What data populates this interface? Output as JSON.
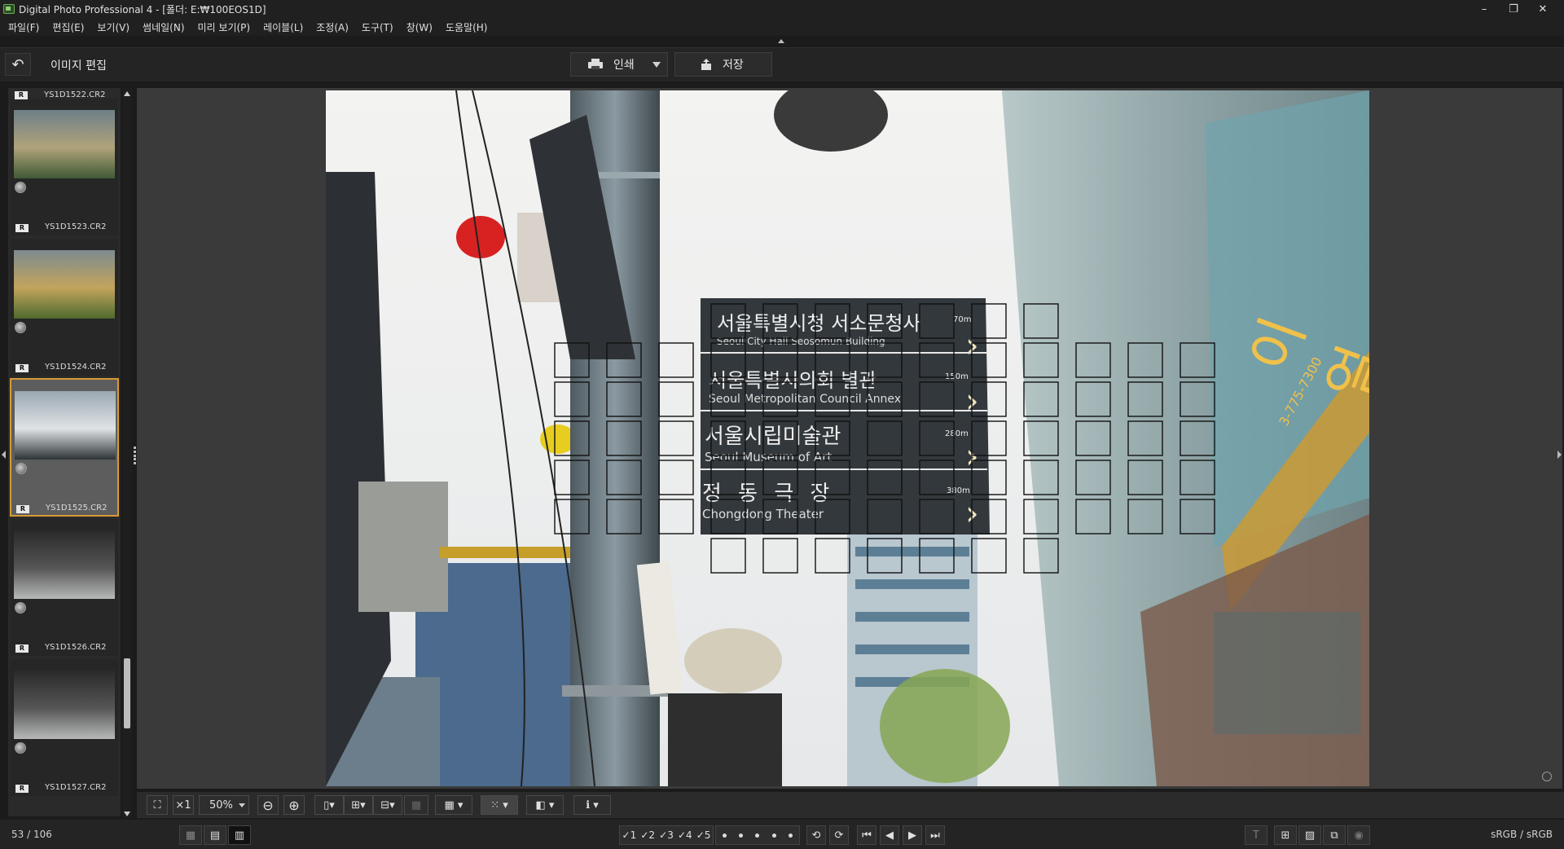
{
  "window": {
    "title": "Digital Photo Professional 4 - [폴더: E:₩100EOS1D]",
    "controls": {
      "minimize": "–",
      "restore": "❐",
      "close": "✕"
    }
  },
  "menu": [
    "파일(F)",
    "편집(E)",
    "보기(V)",
    "썸네일(N)",
    "미리 보기(P)",
    "레이블(L)",
    "조정(A)",
    "도구(T)",
    "창(W)",
    "도움말(H)"
  ],
  "toolbar": {
    "back_icon": "↶",
    "page_title": "이미지 편집",
    "print_label": "인쇄",
    "save_label": "저장"
  },
  "filmstrip": {
    "top_file": "YS1D1522.CR2",
    "raw_badge": "R",
    "items": [
      {
        "file": "YS1D1523.CR2",
        "selected": false
      },
      {
        "file": "YS1D1524.CR2",
        "selected": false
      },
      {
        "file": "YS1D1525.CR2",
        "selected": true
      },
      {
        "file": "YS1D1526.CR2",
        "selected": false
      },
      {
        "file": "YS1D1527.CR2",
        "selected": false
      }
    ]
  },
  "photo": {
    "signs": [
      {
        "ko": "서울특별시청 서소문청사",
        "en": "Seoul City Hall Seosomun Building",
        "dist": "70m"
      },
      {
        "ko": "서울특별시의회 별관",
        "en": "Seoul Metropolitan Council Annex",
        "dist": "150m"
      },
      {
        "ko": "서울시립미술관",
        "en": "Seoul Museum of Art",
        "dist": "280m"
      },
      {
        "ko": "정 동 극 장",
        "en": "Chongdong Theater",
        "dist": "380m"
      }
    ],
    "building_sign": "이얼",
    "phone_text": "3-775-7300"
  },
  "viewbar": {
    "fit_icon": "⛶",
    "x1_label": "×1",
    "zoom_value": "50%",
    "zoom_out_icon": "⊖",
    "zoom_in_icon": "⊕"
  },
  "status": {
    "counter": "53 / 106",
    "stars": [
      "✓1",
      "✓2",
      "✓3",
      "✓4",
      "✓5"
    ],
    "colorspace": "sRGB / sRGB"
  }
}
